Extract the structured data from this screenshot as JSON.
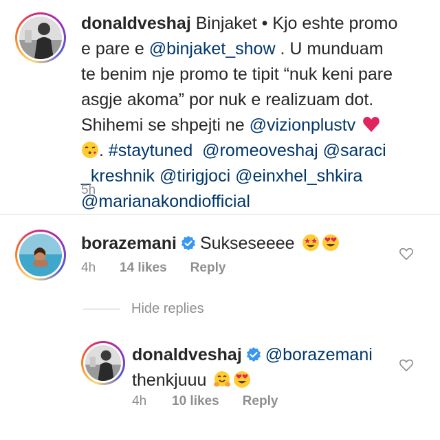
{
  "post_caption": {
    "username": "donaldveshaj",
    "lines": [
      "Binjaket • Kjo eshte promo",
      "e pare e ",
      " . U munduam",
      "te benim nje promo te tipit “nuk keni pare",
      "asgje akoma” por nuk e realizuam dot.",
      "Shihemi se shpejti ne ",
      ". "
    ],
    "mention_binjaket": "@binjaket_show",
    "mention_vizionplus": "@vizionplustv",
    "hashtag": "#staytuned",
    "mention_romeo": "@romeoveshaj",
    "mention_saraci_a": "@saraci",
    "mention_saraci_b": "_kreshnik",
    "mention_tirigjoci": "@tirigjoci",
    "mention_einxhel": "@einxhel_shkira",
    "mention_mariana": "@marianakondiofficial",
    "time": "5h"
  },
  "comment": {
    "username": "borazemani",
    "text": "Sukseseeee",
    "time": "4h",
    "likes": "14 likes",
    "reply_label": "Reply"
  },
  "hide_replies_label": "Hide replies",
  "reply": {
    "username": "donaldveshaj",
    "mention": "@borazemani",
    "text": "thenkjuuu",
    "time": "4h",
    "likes": "10 likes",
    "reply_label": "Reply"
  },
  "colors": {
    "text": "#262626",
    "link": "#00376b",
    "meta": "#8e8e8e",
    "verified": "#3897f0",
    "heart_red": "#e0245e",
    "divider": "#dbdbdb"
  }
}
